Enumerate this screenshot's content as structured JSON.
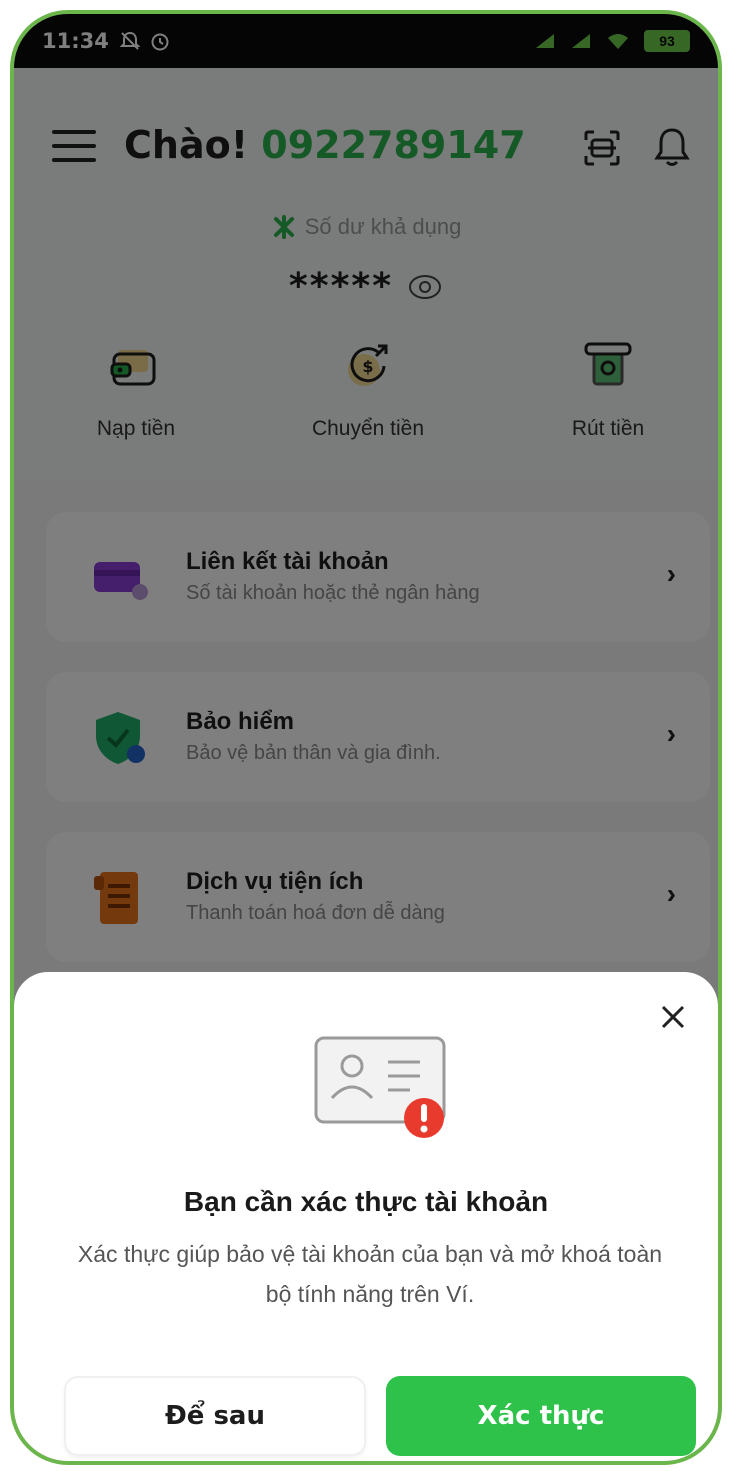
{
  "status_bar": {
    "time": "11:34",
    "battery": "93"
  },
  "header": {
    "greeting": "Chào!",
    "phone_number": "0922789147"
  },
  "balance": {
    "label": "Số dư khả dụng",
    "value": "*****"
  },
  "quick_actions": [
    {
      "label": "Nạp tiền",
      "icon": "wallet-icon"
    },
    {
      "label": "Chuyển tiền",
      "icon": "money-transfer-icon"
    },
    {
      "label": "Rút tiền",
      "icon": "atm-withdraw-icon"
    }
  ],
  "menu_cards": [
    {
      "title": "Liên kết tài khoản",
      "subtitle": "Số tài khoản hoặc thẻ ngân hàng",
      "icon": "card-link-icon"
    },
    {
      "title": "Bảo hiểm",
      "subtitle": "Bảo vệ bản thân và gia đình.",
      "icon": "shield-icon"
    },
    {
      "title": "Dịch vụ tiện ích",
      "subtitle": "Thanh toán hoá đơn dễ dàng",
      "icon": "bill-icon"
    }
  ],
  "verify_sheet": {
    "title": "Bạn cần xác thực tài khoản",
    "description": "Xác thực giúp bảo vệ tài khoản của bạn và mở khoá toàn bộ tính năng trên Ví.",
    "later_label": "Để sau",
    "verify_label": "Xác thực"
  },
  "colors": {
    "brand_green": "#2bb24c",
    "button_green": "#2fc24a",
    "frame_green": "#6bb64a",
    "alert_red": "#e83b2e"
  }
}
